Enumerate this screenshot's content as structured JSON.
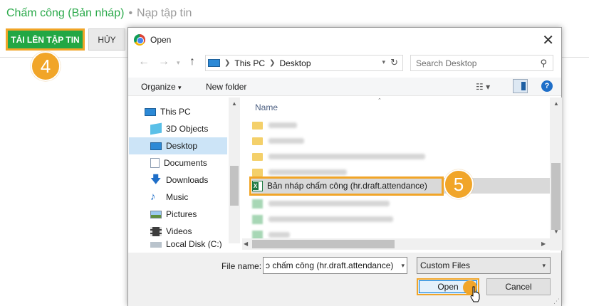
{
  "page": {
    "breadcrumb_active": "Chấm công (Bản nháp)",
    "breadcrumb_sep": "•",
    "breadcrumb_current": "Nạp tập tin",
    "upload_button": "TẢI LÊN TẬP TIN",
    "cancel_button": "HỦY",
    "step4": "4",
    "step5": "5"
  },
  "dialog": {
    "title": "Open",
    "address": {
      "root": "This PC",
      "folder": "Desktop"
    },
    "search_placeholder": "Search Desktop",
    "organize_label": "Organize",
    "new_folder_label": "New folder",
    "nav_items": [
      {
        "label": "This PC",
        "icon": "pc-icon"
      },
      {
        "label": "3D Objects",
        "icon": "cube-icon"
      },
      {
        "label": "Desktop",
        "icon": "desktop-icon",
        "selected": true
      },
      {
        "label": "Documents",
        "icon": "documents-icon"
      },
      {
        "label": "Downloads",
        "icon": "download-icon"
      },
      {
        "label": "Music",
        "icon": "music-icon"
      },
      {
        "label": "Pictures",
        "icon": "pictures-icon"
      },
      {
        "label": "Videos",
        "icon": "videos-icon"
      },
      {
        "label": "Local Disk (C:)",
        "icon": "disk-icon"
      }
    ],
    "column_name": "Name",
    "selected_file": "Bản nháp chấm công (hr.draft.attendance)",
    "file_name_label": "File name:",
    "file_name_value": "ɔ chấm công (hr.draft.attendance)",
    "file_type_value": "Custom Files",
    "open_button": "Open",
    "cancel_button": "Cancel"
  }
}
